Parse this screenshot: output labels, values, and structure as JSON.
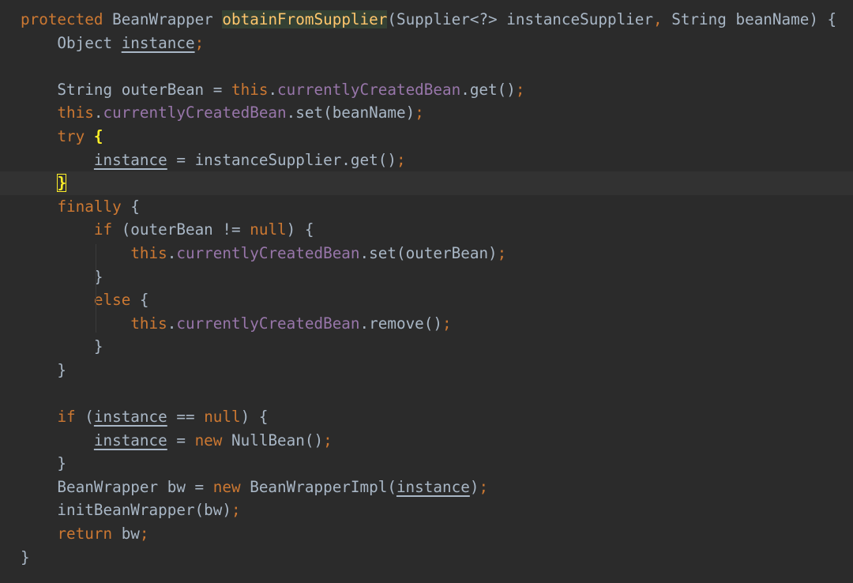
{
  "editor": {
    "language": "java",
    "colors": {
      "background": "#2b2b2b",
      "current_line": "#323232",
      "keyword": "#cc7832",
      "text": "#a9b7c6",
      "field": "#9876aa",
      "method_declaration": "#ffc66d",
      "brace_match": "#ffef28"
    },
    "lines": [
      [
        {
          "t": "protected ",
          "c": "kw"
        },
        {
          "t": "BeanWrapper ",
          "c": "plain"
        },
        {
          "t": "obtainFromSupplier",
          "c": "mth",
          "hl": "def"
        },
        {
          "t": "(Supplier<?> instanceSupplier",
          "c": "plain"
        },
        {
          "t": ", ",
          "c": "kw"
        },
        {
          "t": "String beanName) {",
          "c": "plain"
        }
      ],
      [
        {
          "t": "    Object ",
          "c": "plain"
        },
        {
          "t": "instance",
          "c": "plain",
          "u": true
        },
        {
          "t": ";",
          "c": "kw"
        }
      ],
      [],
      [
        {
          "t": "    String outerBean = ",
          "c": "plain"
        },
        {
          "t": "this",
          "c": "kw"
        },
        {
          "t": ".",
          "c": "plain"
        },
        {
          "t": "currentlyCreatedBean",
          "c": "fld"
        },
        {
          "t": ".get()",
          "c": "plain"
        },
        {
          "t": ";",
          "c": "kw"
        }
      ],
      [
        {
          "t": "    ",
          "c": "plain"
        },
        {
          "t": "this",
          "c": "kw"
        },
        {
          "t": ".",
          "c": "plain"
        },
        {
          "t": "currentlyCreatedBean",
          "c": "fld"
        },
        {
          "t": ".set(beanName)",
          "c": "plain"
        },
        {
          "t": ";",
          "c": "kw"
        }
      ],
      [
        {
          "t": "    ",
          "c": "plain"
        },
        {
          "t": "try ",
          "c": "kw"
        },
        {
          "t": "{",
          "c": "plain",
          "bm": true
        }
      ],
      [
        {
          "t": "        ",
          "c": "plain"
        },
        {
          "t": "instance",
          "c": "plain",
          "u": true
        },
        {
          "t": " = instanceSupplier.get()",
          "c": "plain"
        },
        {
          "t": ";",
          "c": "kw"
        }
      ],
      [
        {
          "t": "    ",
          "c": "plain"
        },
        {
          "t": "}",
          "c": "plain",
          "bm": true,
          "caret": true
        }
      ],
      [
        {
          "t": "    ",
          "c": "plain"
        },
        {
          "t": "finally ",
          "c": "kw"
        },
        {
          "t": "{",
          "c": "plain"
        }
      ],
      [
        {
          "t": "        ",
          "c": "plain"
        },
        {
          "t": "if ",
          "c": "kw"
        },
        {
          "t": "(outerBean != ",
          "c": "plain"
        },
        {
          "t": "null",
          "c": "kw"
        },
        {
          "t": ") {",
          "c": "plain"
        }
      ],
      [
        {
          "t": "            ",
          "c": "plain"
        },
        {
          "t": "this",
          "c": "kw"
        },
        {
          "t": ".",
          "c": "plain"
        },
        {
          "t": "currentlyCreatedBean",
          "c": "fld"
        },
        {
          "t": ".set(outerBean)",
          "c": "plain"
        },
        {
          "t": ";",
          "c": "kw"
        }
      ],
      [
        {
          "t": "        }",
          "c": "plain"
        }
      ],
      [
        {
          "t": "        ",
          "c": "plain"
        },
        {
          "t": "else ",
          "c": "kw"
        },
        {
          "t": "{",
          "c": "plain"
        }
      ],
      [
        {
          "t": "            ",
          "c": "plain"
        },
        {
          "t": "this",
          "c": "kw"
        },
        {
          "t": ".",
          "c": "plain"
        },
        {
          "t": "currentlyCreatedBean",
          "c": "fld"
        },
        {
          "t": ".remove()",
          "c": "plain"
        },
        {
          "t": ";",
          "c": "kw"
        }
      ],
      [
        {
          "t": "        }",
          "c": "plain"
        }
      ],
      [
        {
          "t": "    }",
          "c": "plain"
        }
      ],
      [],
      [
        {
          "t": "    ",
          "c": "plain"
        },
        {
          "t": "if ",
          "c": "kw"
        },
        {
          "t": "(",
          "c": "plain"
        },
        {
          "t": "instance",
          "c": "plain",
          "u": true
        },
        {
          "t": " == ",
          "c": "plain"
        },
        {
          "t": "null",
          "c": "kw"
        },
        {
          "t": ") {",
          "c": "plain"
        }
      ],
      [
        {
          "t": "        ",
          "c": "plain"
        },
        {
          "t": "instance",
          "c": "plain",
          "u": true
        },
        {
          "t": " = ",
          "c": "plain"
        },
        {
          "t": "new ",
          "c": "kw"
        },
        {
          "t": "NullBean()",
          "c": "plain"
        },
        {
          "t": ";",
          "c": "kw"
        }
      ],
      [
        {
          "t": "    }",
          "c": "plain"
        }
      ],
      [
        {
          "t": "    BeanWrapper bw = ",
          "c": "plain"
        },
        {
          "t": "new ",
          "c": "kw"
        },
        {
          "t": "BeanWrapperImpl(",
          "c": "plain"
        },
        {
          "t": "instance",
          "c": "plain",
          "u": true
        },
        {
          "t": ")",
          "c": "plain"
        },
        {
          "t": ";",
          "c": "kw"
        }
      ],
      [
        {
          "t": "    initBeanWrapper(bw)",
          "c": "plain"
        },
        {
          "t": ";",
          "c": "kw"
        }
      ],
      [
        {
          "t": "    ",
          "c": "plain"
        },
        {
          "t": "return ",
          "c": "kw"
        },
        {
          "t": "bw",
          "c": "plain"
        },
        {
          "t": ";",
          "c": "kw"
        }
      ],
      [
        {
          "t": "}",
          "c": "plain"
        }
      ]
    ],
    "current_line_index": 7
  }
}
